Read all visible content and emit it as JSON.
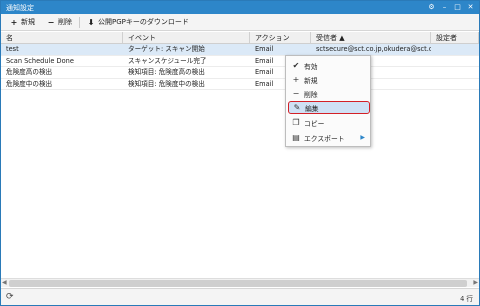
{
  "window": {
    "title": "通知設定",
    "controls": [
      {
        "name": "settings-icon",
        "glyph": "⚙"
      },
      {
        "name": "minimize-icon",
        "glyph": "–"
      },
      {
        "name": "maximize-icon",
        "glyph": "□"
      },
      {
        "name": "close-icon",
        "glyph": "✕"
      }
    ]
  },
  "toolbar": {
    "new_icon": "+",
    "new_label": "新規",
    "delete_icon": "−",
    "delete_label": "削除",
    "download_icon": "⬇",
    "download_label": "公開PGPキーのダウンロード"
  },
  "table": {
    "columns": [
      "名",
      "イベント",
      "アクション",
      "受信者 ▲",
      "設定者"
    ],
    "rows": [
      [
        "test",
        "ターゲット: スキャン開始",
        "Email",
        "sctsecure@sct.co.jp,okudera@sct.c...",
        ""
      ],
      [
        "Scan Schedule Done",
        "スキャンスケジュール完了",
        "Email",
        "",
        ""
      ],
      [
        "危険度高の検出",
        "検知項目: 危険度高の検出",
        "Email",
        "",
        ""
      ],
      [
        "危険度中の検出",
        "検知項目: 危険度中の検出",
        "Email",
        "",
        ""
      ]
    ]
  },
  "context_menu": {
    "items": [
      {
        "icon": "✔",
        "icon_name": "check-icon",
        "label": "有効",
        "name": "menu-item-enable"
      },
      {
        "icon": "+",
        "icon_name": "plus-icon",
        "label": "新規",
        "name": "menu-item-new"
      },
      {
        "icon": "−",
        "icon_name": "minus-icon",
        "label": "削除",
        "name": "menu-item-delete"
      },
      {
        "icon": "✎",
        "icon_name": "pencil-icon",
        "label": "編集",
        "name": "menu-item-edit"
      },
      {
        "icon": "❐",
        "icon_name": "copy-icon",
        "label": "コピー",
        "name": "menu-item-copy"
      },
      {
        "icon": "▤",
        "icon_name": "printer-icon",
        "label": "エクスポート",
        "name": "menu-item-export"
      }
    ],
    "export_arrow": "▶"
  },
  "status": {
    "refresh_icon": "⟳",
    "row_count": "4 行"
  },
  "colors": {
    "titlebar": "#2d86c9",
    "selection": "#dbe9f7",
    "highlight_border": "#d32027"
  }
}
